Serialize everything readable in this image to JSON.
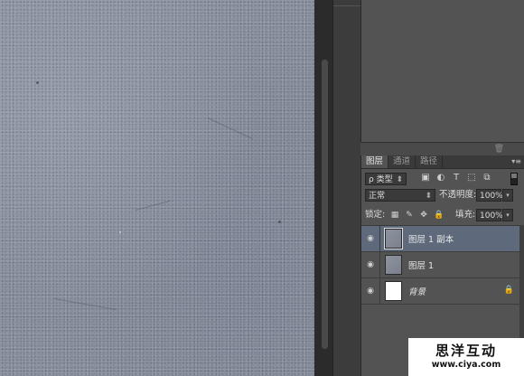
{
  "layers_panel": {
    "tabs": [
      "图层",
      "通道",
      "路径"
    ],
    "active_tab": "图层",
    "kind_filter": {
      "label": "ρ 类型"
    },
    "filter_icons": [
      "image-filter-icon",
      "adjustment-filter-icon",
      "type-filter-icon",
      "shape-filter-icon",
      "smart-object-filter-icon"
    ],
    "blend_mode": "正常",
    "opacity_label": "不透明度:",
    "opacity_value": "100%",
    "lock_label": "锁定:",
    "fill_label": "填充:",
    "fill_value": "100%",
    "layers": [
      {
        "name": "图层 1 副本",
        "visible": true,
        "selected": true,
        "thumbnail": "concrete"
      },
      {
        "name": "图层 1",
        "visible": true,
        "selected": false,
        "thumbnail": "concrete"
      },
      {
        "name": "背景",
        "visible": true,
        "selected": false,
        "thumbnail": "white",
        "locked": true
      }
    ]
  },
  "watermark": {
    "title": "思洋互动",
    "url": "www.ciya.com"
  },
  "colors": {
    "panel_bg": "#535353",
    "selected_layer": "#5e6a7c",
    "canvas": "#8a8f9b"
  }
}
